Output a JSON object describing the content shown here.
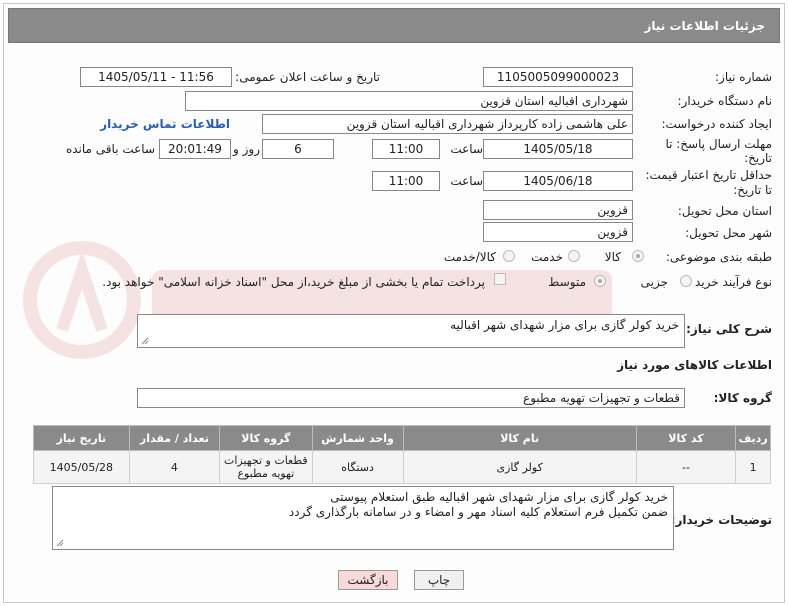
{
  "header": {
    "title": "جزئیات اطلاعات نیاز"
  },
  "fields": {
    "need_number_label": "شماره نیاز:",
    "need_number": "1105005099000023",
    "announce_label": "تاریخ و ساعت اعلان عمومی:",
    "announce_value": "1405/05/11 - 11:56",
    "buyer_org_label": "نام دستگاه خریدار:",
    "buyer_org": "شهرداری اقبالیه استان قزوین",
    "creator_label": "ایجاد کننده درخواست:",
    "creator": "علی هاشمی زاده کارپرداز شهرداری اقبالیه استان قزوین",
    "contact_link": "اطلاعات تماس خریدار",
    "deadline_label_1": "مهلت ارسال پاسخ: تا",
    "deadline_label_2": "تاریخ:",
    "deadline_date": "1405/05/18",
    "time_word": "ساعت",
    "deadline_time": "11:00",
    "days_value": "6",
    "days_word": "روز و",
    "remaining_time": "20:01:49",
    "remaining_word": "ساعت باقی مانده",
    "price_label_1": "حداقل تاریخ اعتبار قیمت:",
    "price_label_2": "تا تاریخ:",
    "price_date": "1405/06/18",
    "price_time": "11:00",
    "province_label": "استان محل تحویل:",
    "province": "قزوین",
    "city_label": "شهر محل تحویل:",
    "city": "قزوین",
    "category_label": "طبقه بندی موضوعی:",
    "category_options": [
      "کالا",
      "خدمت",
      "کالا/خدمت"
    ],
    "process_label": "نوع فرآیند خرید :",
    "process_options": [
      "جزیی",
      "متوسط"
    ],
    "payment_note": "پرداخت تمام یا بخشی از مبلغ خرید،از محل \"اسناد خزانه اسلامی\" خواهد بود."
  },
  "summary": {
    "label": "شرح کلی نیاز:",
    "text": "خرید کولر گازی برای مزار شهدای شهر اقبالیه"
  },
  "goods": {
    "section_title": "اطلاعات کالاهای مورد نیاز",
    "group_label": "گروه کالا:",
    "group_value": "قطعات و تجهیزات تهویه مطبوع",
    "table": {
      "headers": [
        "ردیف",
        "کد کالا",
        "نام کالا",
        "واحد شمارش",
        "گروه کالا",
        "تعداد / مقدار",
        "تاریخ نیاز"
      ],
      "rows": [
        {
          "row": "1",
          "code": "--",
          "name": "کولر گازی",
          "unit": "دستگاه",
          "group_1": "قطعات و تجهیزات",
          "group_2": "تهویه مطبوع",
          "qty": "4",
          "date": "1405/05/28"
        }
      ]
    }
  },
  "buyer_notes": {
    "label": "توضیحات خریدار:",
    "line_1": "خرید کولر گازی برای مزار شهدای شهر اقبالیه طبق استعلام پیوستی",
    "line_2": "ضمن تکمیل فرم استعلام کلیه اسناد مهر و امضاء و در سامانه بارگذاری گردد"
  },
  "buttons": {
    "print": "چاپ",
    "back": "بازگشت"
  },
  "colors": {
    "header_bg": "#8a8a8a",
    "link": "#2a5db0",
    "back_button": "#f9d9d9",
    "print_button": "#f0f0f0"
  }
}
